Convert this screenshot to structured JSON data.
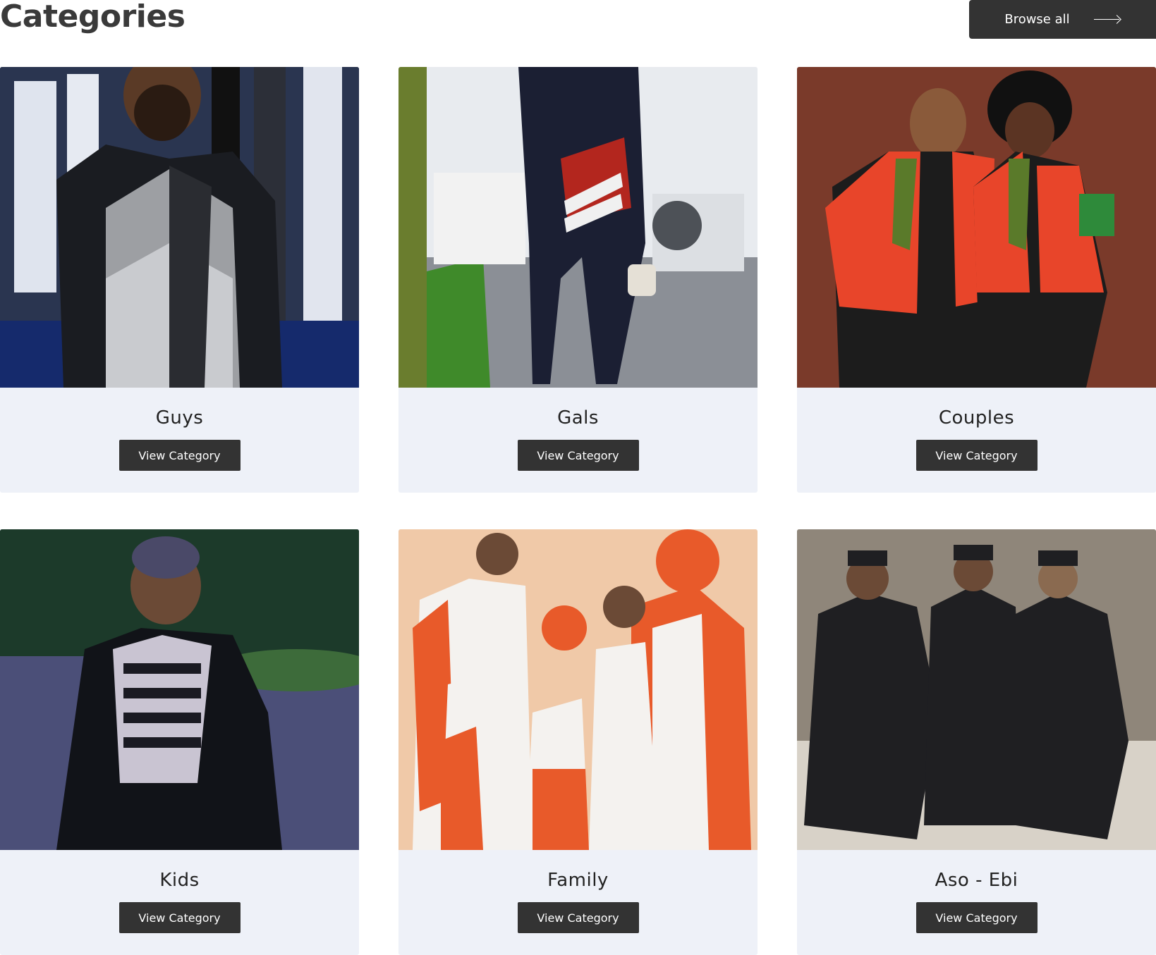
{
  "header": {
    "title": "Categories",
    "browse_label": "Browse all",
    "browse_icon": "arrow-right-icon"
  },
  "categories": [
    {
      "name": "Guys",
      "button": "View Category",
      "image": "man-in-black-grey-kaftan-photo"
    },
    {
      "name": "Gals",
      "button": "View Category",
      "image": "woman-in-navy-outfit-photo"
    },
    {
      "name": "Couples",
      "button": "View Category",
      "image": "couple-in-red-dashiki-jackets-photo"
    },
    {
      "name": "Kids",
      "button": "View Category",
      "image": "child-in-black-agbada-photo"
    },
    {
      "name": "Family",
      "button": "View Category",
      "image": "family-in-orange-aso-oke-photo"
    },
    {
      "name": "Aso - Ebi",
      "button": "View Category",
      "image": "three-men-in-black-agbada-photo"
    }
  ],
  "colors": {
    "button_bg": "#333333",
    "card_bg": "#eef1f8",
    "text": "#222222"
  }
}
